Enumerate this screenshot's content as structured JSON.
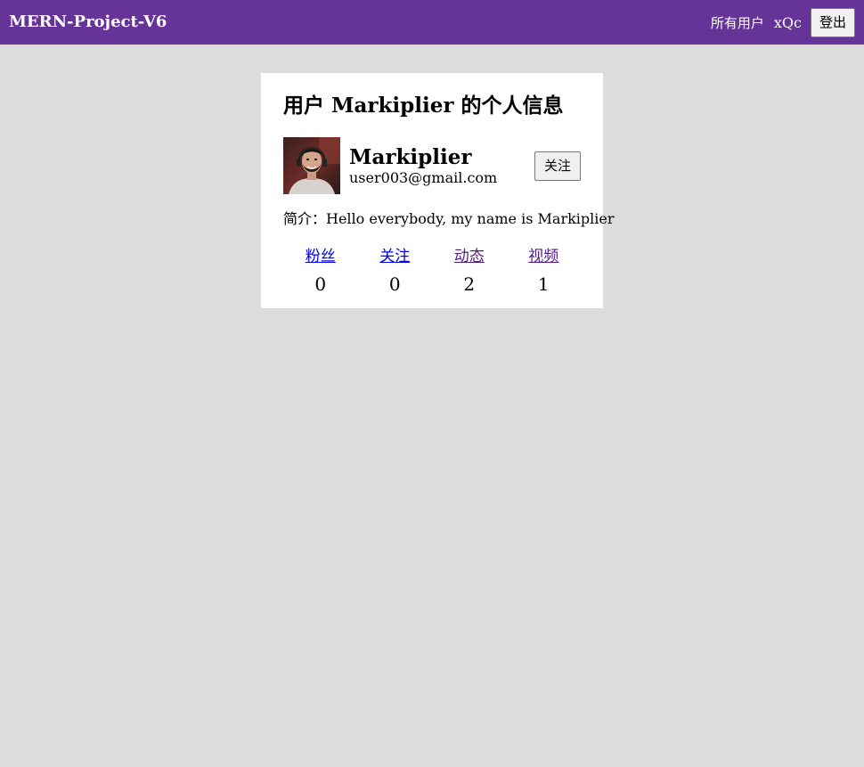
{
  "header": {
    "brand": "MERN-Project-V6",
    "nav_all_users": "所有用户",
    "current_user": "xQc",
    "logout_label": "登出",
    "bg_color": "#663399"
  },
  "profile": {
    "title": "用户 Markiplier 的个人信息",
    "name": "Markiplier",
    "email": "user003@gmail.com",
    "follow_label": "关注",
    "bio": "简介：Hello everybody, my name is Markiplier",
    "stats": [
      {
        "label": "粉丝",
        "value": "0",
        "visited": false
      },
      {
        "label": "关注",
        "value": "0",
        "visited": false
      },
      {
        "label": "动态",
        "value": "2",
        "visited": true
      },
      {
        "label": "视频",
        "value": "1",
        "visited": true
      }
    ]
  },
  "colors": {
    "page_bg": "#dcdcdc",
    "link_unvisited": "#0000ee",
    "link_visited": "#551a8b"
  }
}
